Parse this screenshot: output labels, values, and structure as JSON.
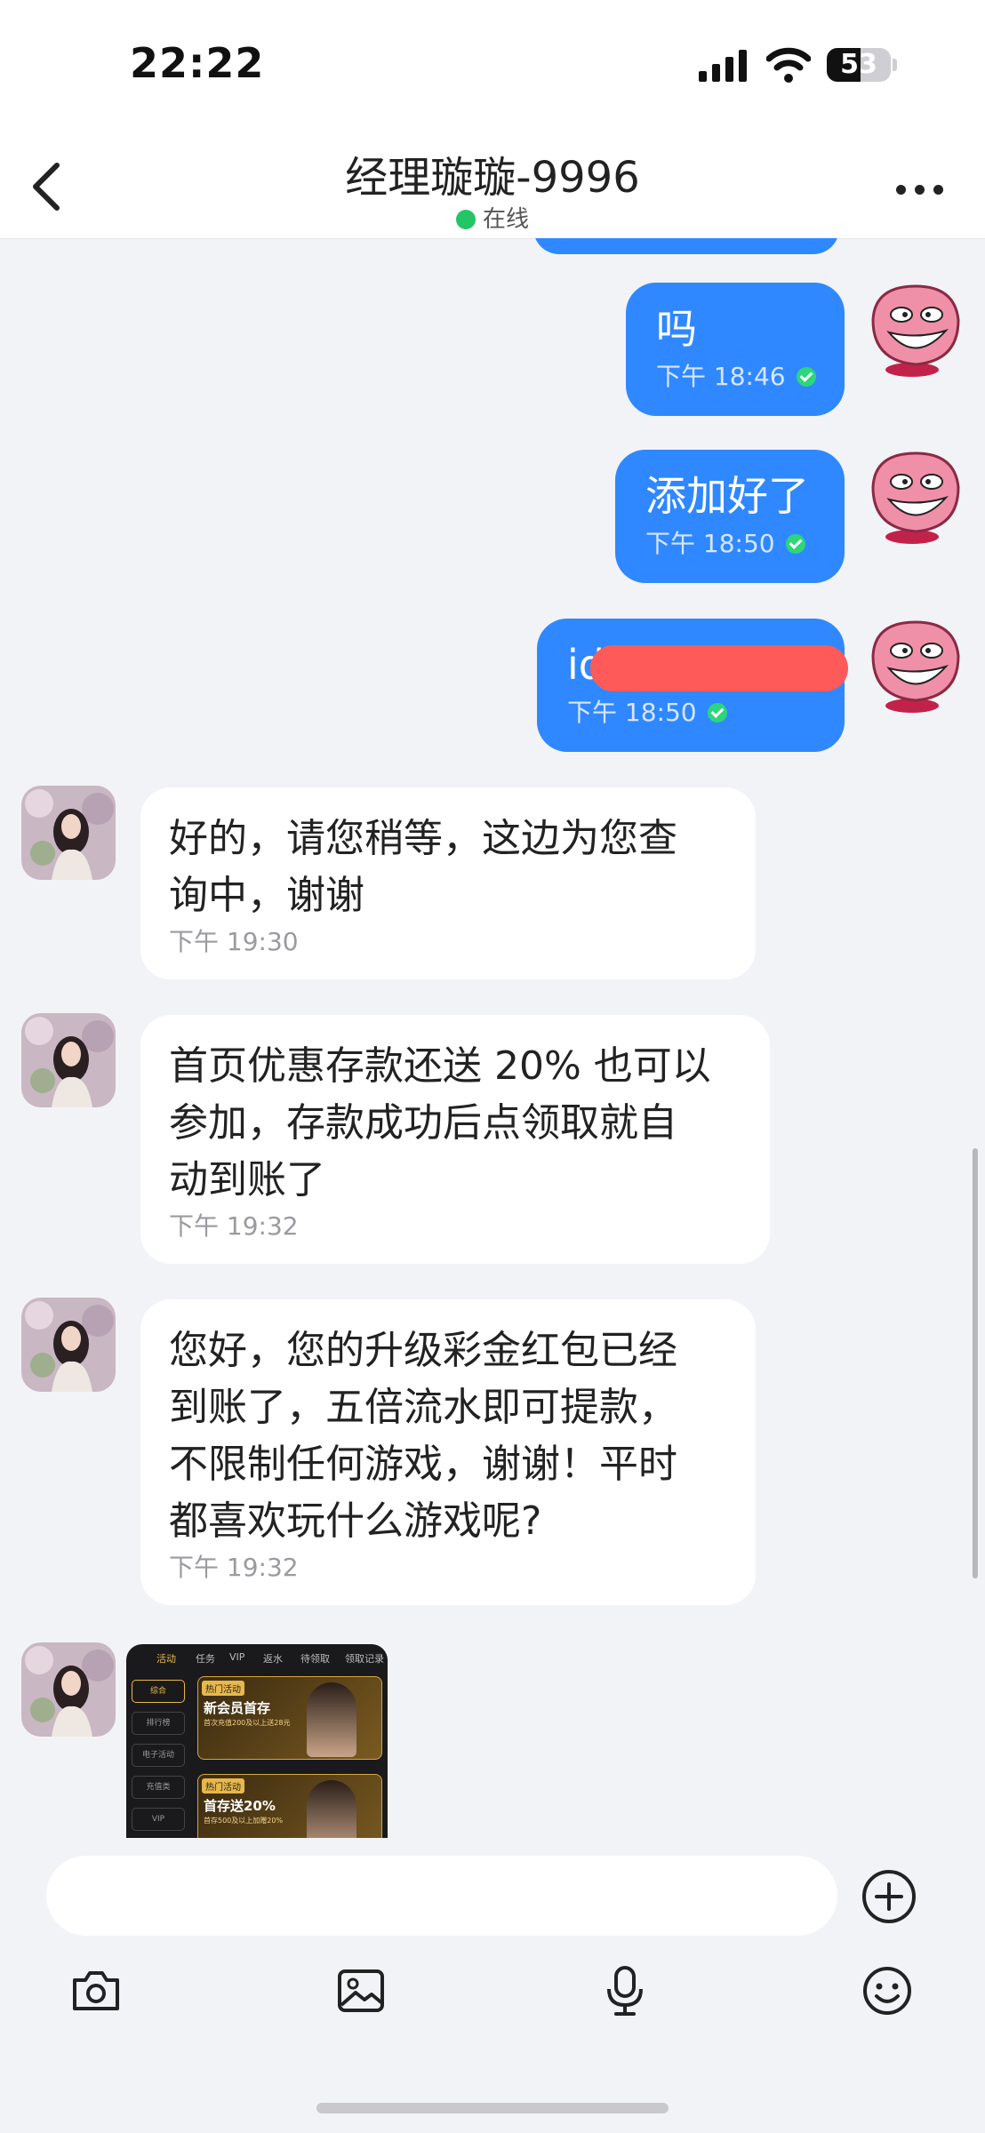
{
  "status_bar": {
    "time": "22:22",
    "battery": "53"
  },
  "header": {
    "title": "经理璇璇-9996",
    "online_label": "在线"
  },
  "messages_out": [
    {
      "text": "吗",
      "time": "下午 18:46"
    },
    {
      "text": "添加好了",
      "time": "下午 18:50"
    },
    {
      "text": "id",
      "time": "下午 18:50"
    }
  ],
  "messages_in": [
    {
      "lines": [
        "好的，请您稍等，这边为您查",
        "询中，谢谢"
      ],
      "time": "下午 19:30"
    },
    {
      "lines": [
        "首页优惠存款还送 20% 也可以",
        "参加，存款成功后点领取就自",
        "动到账了"
      ],
      "time": "下午 19:32"
    },
    {
      "lines": [
        "您好，您的升级彩金红包已经",
        "到账了，五倍流水即可提款，",
        "不限制任何游戏，谢谢！平时",
        "都喜欢玩什么游戏呢?"
      ],
      "time": "下午 19:32"
    }
  ],
  "image_message": {
    "tabs": [
      "活动",
      "任务",
      "VIP",
      "返水",
      "待领取",
      "领取记录"
    ],
    "side_items": [
      "综合",
      "排行榜",
      "电子活动",
      "充值类",
      "VIP"
    ],
    "banners": [
      {
        "tag": "热门活动",
        "head": "新会员首存",
        "sub": "首次充值200及以上送28元"
      },
      {
        "tag": "热门活动",
        "head": "首存送20%",
        "sub": "首存500及以上加赠20%"
      }
    ]
  },
  "icons": [
    "back-icon",
    "more-icon",
    "check-icon",
    "plus-icon",
    "camera-icon",
    "image-icon",
    "microphone-icon",
    "emoji-icon"
  ]
}
